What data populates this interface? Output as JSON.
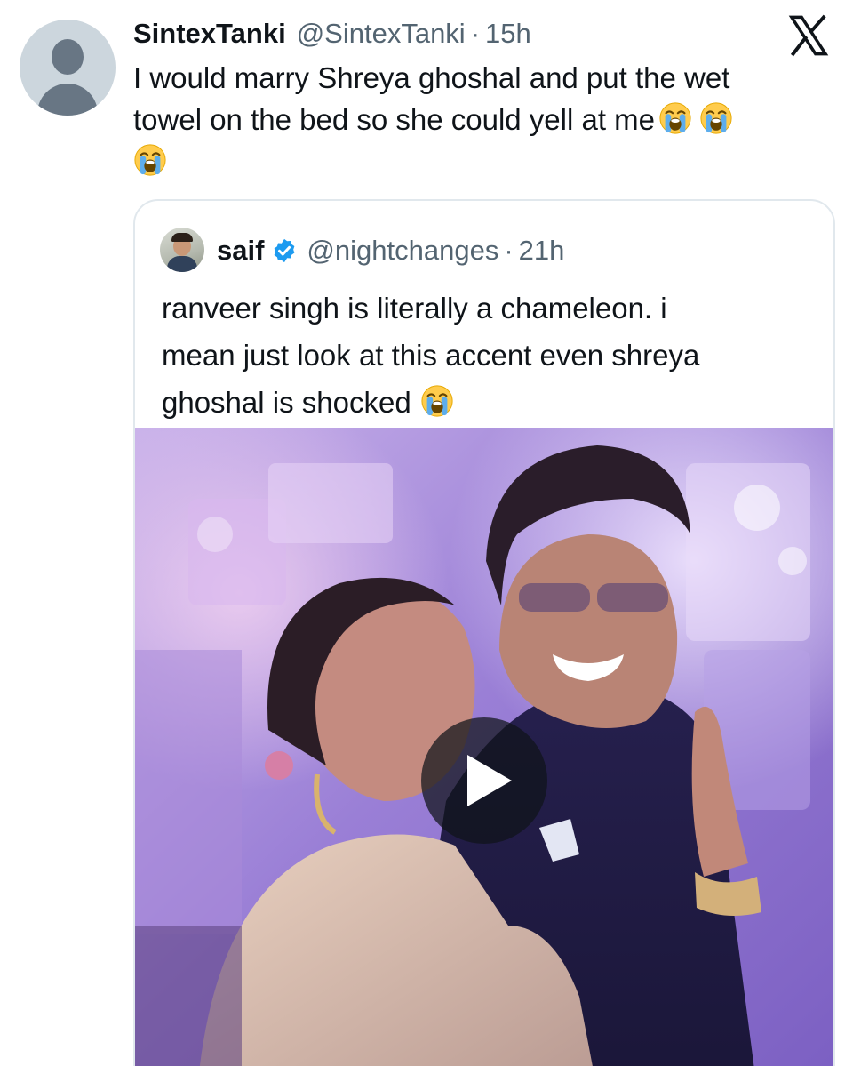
{
  "tweet": {
    "display_name": "SintexTanki",
    "handle": "@SintexTanki",
    "separator": "·",
    "time": "15h",
    "text_line1": "I would marry Shreya ghoshal and put the wet",
    "text_line2": "towel on the bed so she could yell at me",
    "emoji": [
      "loudly-crying-face",
      "loudly-crying-face",
      "loudly-crying-face"
    ],
    "avatar": "default-profile-avatar"
  },
  "platform": {
    "logo": "x-logo"
  },
  "quoted_tweet": {
    "display_name": "saif",
    "verified": true,
    "verified_color": "#1d9bf0",
    "handle": "@nightchanges",
    "separator": "·",
    "time": "21h",
    "text_line1": "ranveer singh is literally a chameleon. i",
    "text_line2": "mean just look at this accent even shreya",
    "text_line3": "ghoshal is shocked",
    "emoji": [
      "loudly-crying-face"
    ],
    "media": {
      "type": "video",
      "control": "play-icon"
    }
  },
  "colors": {
    "text_primary": "#0f1419",
    "text_secondary": "#536471",
    "border": "#e1e8ed",
    "verified_blue": "#1d9bf0"
  }
}
